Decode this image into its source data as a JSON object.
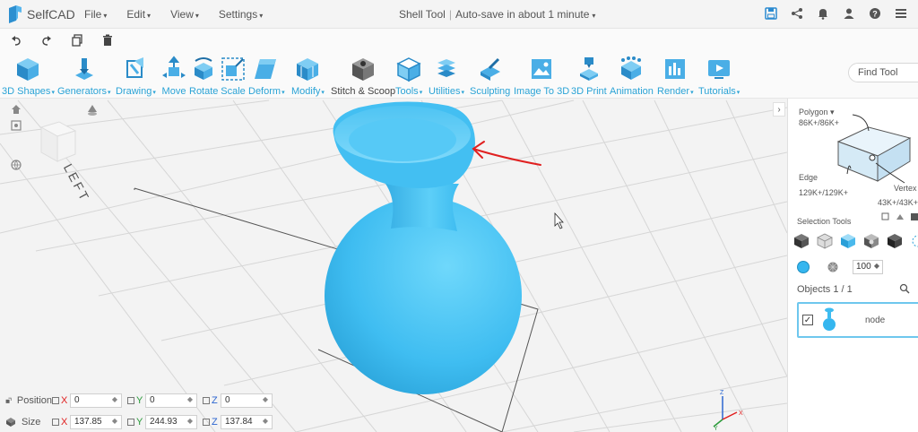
{
  "app": {
    "name": "SelfCAD"
  },
  "menu": [
    {
      "label": "File"
    },
    {
      "label": "Edit"
    },
    {
      "label": "View"
    },
    {
      "label": "Settings"
    }
  ],
  "document": {
    "tool": "Shell Tool",
    "status": "Auto-save in about 1 minute"
  },
  "toolbar": {
    "items": [
      {
        "label": "3D Shapes",
        "dropdown": true
      },
      {
        "label": "Generators",
        "dropdown": true
      },
      {
        "label": "Drawing",
        "dropdown": true
      },
      {
        "label": "Move",
        "dropdown": false
      },
      {
        "label": "Rotate",
        "dropdown": false
      },
      {
        "label": "Scale",
        "dropdown": false
      },
      {
        "label": "Deform",
        "dropdown": true
      },
      {
        "label": "Modify",
        "dropdown": true
      },
      {
        "label": "Stitch & Scoop",
        "dropdown": false
      },
      {
        "label": "Tools",
        "dropdown": true
      },
      {
        "label": "Utilities",
        "dropdown": true
      },
      {
        "label": "Sculpting",
        "dropdown": false
      },
      {
        "label": "Image To 3D",
        "dropdown": false
      },
      {
        "label": "3D Print",
        "dropdown": false
      },
      {
        "label": "Animation",
        "dropdown": false
      },
      {
        "label": "Render",
        "dropdown": true
      },
      {
        "label": "Tutorials",
        "dropdown": true
      }
    ],
    "find_placeholder": "Find Tool"
  },
  "viewcube": {
    "face_label": "LEFT"
  },
  "transform": {
    "position": {
      "label": "Position",
      "x": "0",
      "y": "0",
      "z": "0"
    },
    "size": {
      "label": "Size",
      "x": "137.85",
      "y": "244.93",
      "z": "137.84"
    },
    "axis_labels": {
      "x": "X",
      "y": "Y",
      "z": "Z"
    }
  },
  "panel": {
    "polygon_label": "Polygon",
    "polygon_count": "86K+/86K+",
    "edge_label": "Edge",
    "edge_count": "129K+/129K+",
    "vertex_label": "Vertex",
    "vertex_count": "43K+/43K+",
    "selection_tools_title": "Selection Tools",
    "opacity_value": "100",
    "objects_title": "Objects 1 / 1",
    "object_name": "node",
    "object_color": "#35b6ef"
  },
  "colors": {
    "accent": "#2aa3d6",
    "object": "#5cc8f5",
    "annotation": "#e02020"
  }
}
